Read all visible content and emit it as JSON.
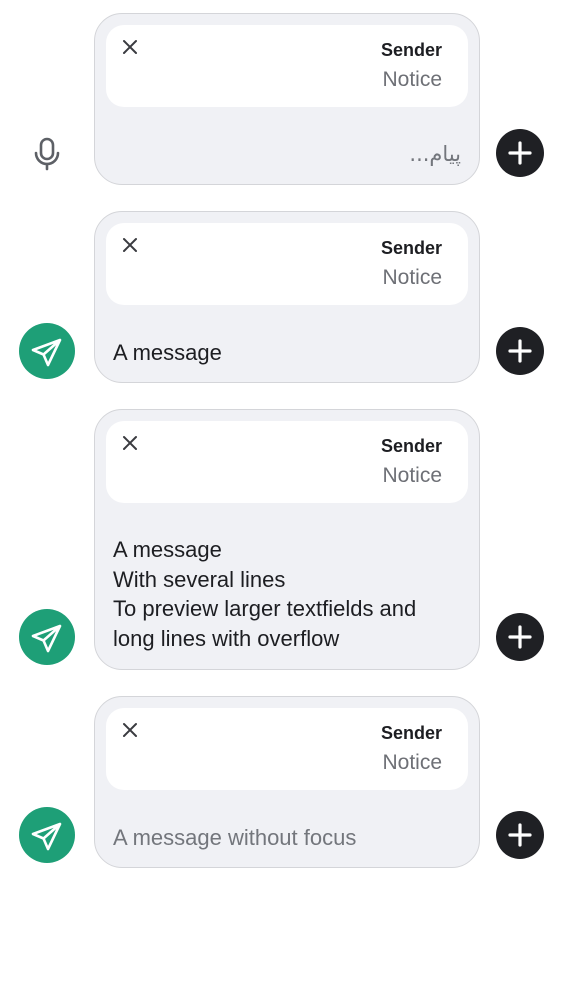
{
  "composers": [
    {
      "reply": {
        "sender": "Sender",
        "notice": "Notice"
      },
      "message": {
        "value": "",
        "placeholder": "پیام..."
      },
      "left_action": "microphone-icon",
      "right_action": "plus-icon"
    },
    {
      "reply": {
        "sender": "Sender",
        "notice": "Notice"
      },
      "message": {
        "value": "A message",
        "placeholder": ""
      },
      "left_action": "send-icon",
      "right_action": "plus-icon"
    },
    {
      "reply": {
        "sender": "Sender",
        "notice": "Notice"
      },
      "message": {
        "value": "A message\nWith several lines\nTo preview larger textfields and\nlong lines with overflow",
        "placeholder": ""
      },
      "left_action": "send-icon",
      "right_action": "plus-icon"
    },
    {
      "reply": {
        "sender": "Sender",
        "notice": "Notice"
      },
      "message": {
        "value": "",
        "placeholder": "A message without focus"
      },
      "left_action": "send-icon",
      "right_action": "plus-icon"
    }
  ],
  "colors": {
    "send": "#1e9f77",
    "plus": "#1f2024",
    "field": "#f0f1f5"
  }
}
